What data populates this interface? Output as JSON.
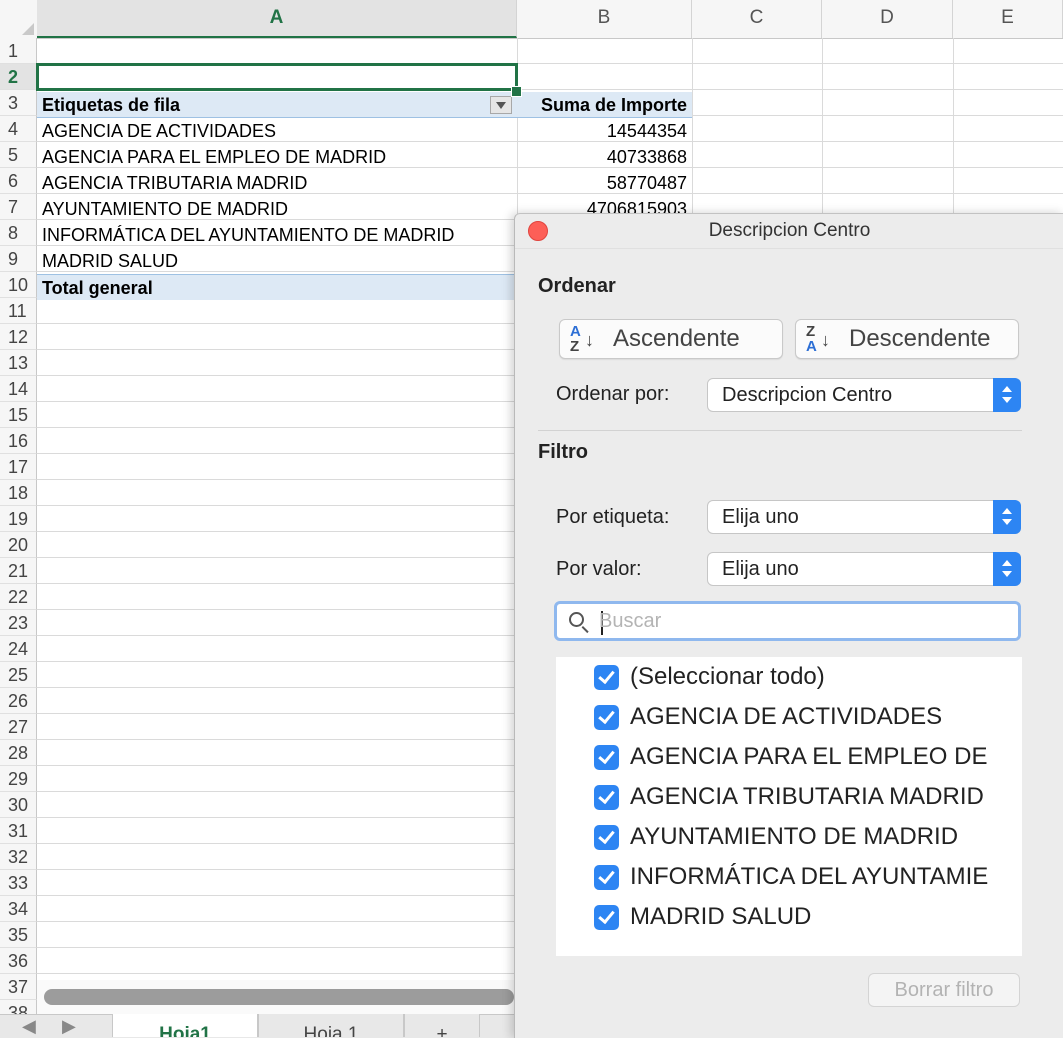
{
  "sheet": {
    "columns": [
      "A",
      "B",
      "C",
      "D",
      "E"
    ],
    "active_column": "A",
    "active_row": 2,
    "row_numbers": [
      "1",
      "2",
      "3",
      "4",
      "5",
      "6",
      "7",
      "8",
      "9",
      "10",
      "11",
      "12",
      "13",
      "14",
      "15",
      "16",
      "17",
      "18",
      "19",
      "20",
      "21",
      "22",
      "23",
      "24",
      "25",
      "26",
      "27",
      "28",
      "29",
      "30",
      "31",
      "32",
      "33",
      "34",
      "35",
      "36",
      "37",
      "38"
    ],
    "pivot": {
      "header_label": "Etiquetas de fila",
      "header_value": "Suma de Importe",
      "rows": [
        {
          "label": "AGENCIA DE ACTIVIDADES",
          "value": "14544354"
        },
        {
          "label": "AGENCIA PARA EL EMPLEO DE MADRID",
          "value": "40733868"
        },
        {
          "label": "AGENCIA TRIBUTARIA MADRID",
          "value": "58770487"
        },
        {
          "label": "AYUNTAMIENTO DE MADRID",
          "value": "4706815903"
        },
        {
          "label": "INFORMÁTICA DEL AYUNTAMIENTO DE MADRID",
          "value": ""
        },
        {
          "label": "MADRID SALUD",
          "value": ""
        }
      ],
      "total_label": "Total general"
    },
    "tabs": [
      {
        "label": "Hoja1",
        "active": true
      },
      {
        "label": "Hoja 1",
        "active": false
      }
    ],
    "add_sheet_label": "+",
    "accent_color": "#217346"
  },
  "popover": {
    "title": "Descripcion Centro",
    "sort_section": "Ordenar",
    "ascending_label": "Ascendente",
    "descending_label": "Descendente",
    "sort_by_label": "Ordenar por:",
    "sort_by_value": "Descripcion Centro",
    "filter_section": "Filtro",
    "by_label_label": "Por etiqueta:",
    "by_label_value": "Elija uno",
    "by_value_label": "Por valor:",
    "by_value_value": "Elija uno",
    "search_placeholder": "Buscar",
    "items": [
      {
        "label": "(Seleccionar todo)",
        "checked": true
      },
      {
        "label": "AGENCIA DE ACTIVIDADES",
        "checked": true
      },
      {
        "label": "AGENCIA PARA EL EMPLEO DE",
        "checked": true
      },
      {
        "label": "AGENCIA TRIBUTARIA MADRID",
        "checked": true
      },
      {
        "label": "AYUNTAMIENTO DE MADRID",
        "checked": true
      },
      {
        "label": "INFORMÁTICA DEL AYUNTAMIE",
        "checked": true
      },
      {
        "label": "MADRID SALUD",
        "checked": true
      }
    ],
    "clear_filter_label": "Borrar filtro",
    "accent_color": "#2d85f3"
  }
}
